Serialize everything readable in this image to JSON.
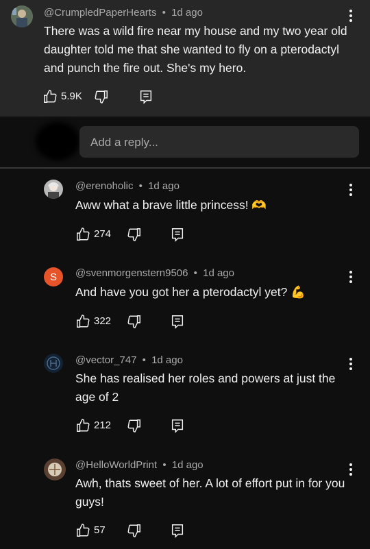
{
  "top_comment": {
    "handle": "@CrumpledPaperHearts",
    "time": "1d ago",
    "text": "There was a wild fire near my house and my two year old daughter told me that she wanted to fly on a pterodactyl and punch the fire out. She's my hero.",
    "likes": "5.9K"
  },
  "reply_input": {
    "placeholder": "Add a reply..."
  },
  "replies": [
    {
      "handle": "@erenoholic",
      "time": "1d ago",
      "text": "Aww what a brave little princess! 🫶",
      "likes": "274",
      "avatar_color": "#8a8a8a"
    },
    {
      "handle": "@svenmorgenstern9506",
      "time": "1d ago",
      "text": "And have you got her a pterodactyl yet? 💪",
      "likes": "322",
      "avatar_letter": "S",
      "avatar_color": "#e8542a"
    },
    {
      "handle": "@vector_747",
      "time": "1d ago",
      "text": "She has realised her roles and powers at just the age of 2",
      "likes": "212",
      "avatar_color": "#1b2a3a"
    },
    {
      "handle": "@HelloWorldPrint",
      "time": "1d ago",
      "text": "Awh, thats sweet of her. A lot of effort put in for you guys!",
      "likes": "57",
      "avatar_color": "#6b4b2b"
    }
  ],
  "icons": [
    "like-icon",
    "dislike-icon",
    "reply-icon",
    "more-options-icon"
  ],
  "separator": "•"
}
